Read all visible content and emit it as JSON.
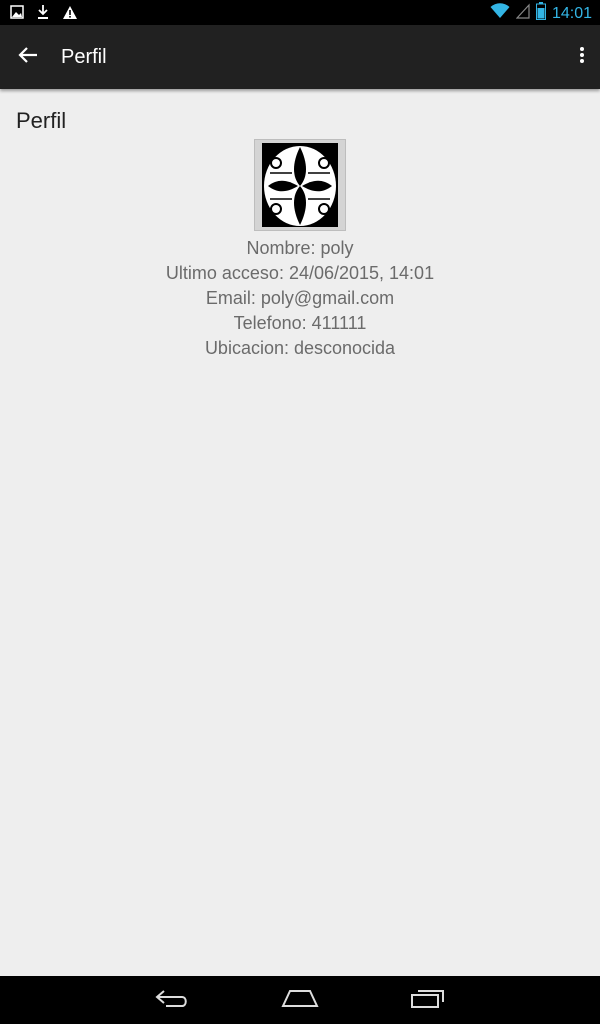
{
  "status_bar": {
    "time": "14:01",
    "left_icons": [
      "image-icon",
      "download-icon",
      "warning-icon"
    ],
    "right_icons": [
      "wifi-icon",
      "signal-icon",
      "battery-icon"
    ],
    "accent_color": "#33b5e5"
  },
  "action_bar": {
    "title": "Perfil",
    "back_icon": "arrow-left-icon",
    "menu_icon": "overflow-menu-icon"
  },
  "profile": {
    "section_title": "Perfil",
    "avatar_icon": "profile-avatar-image",
    "name": "Nombre: poly",
    "last_access": "Ultimo acceso: 24/06/2015, 14:01",
    "email": "Email: poly@gmail.com",
    "phone": "Telefono: 411111",
    "location": "Ubicacion: desconocida"
  },
  "nav_bar": {
    "icons": [
      "back-icon",
      "home-icon",
      "recents-icon"
    ]
  }
}
